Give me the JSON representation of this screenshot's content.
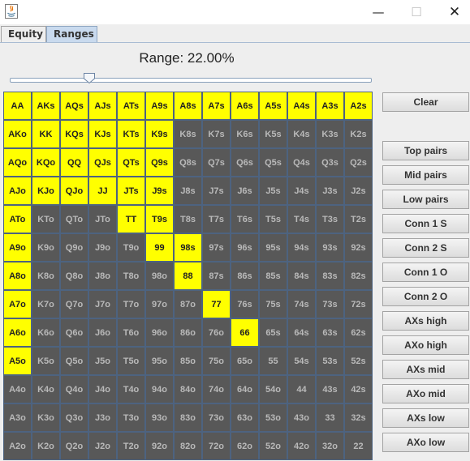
{
  "window": {
    "minimize": "—",
    "maximize": "☐",
    "close": "✕"
  },
  "tabs": [
    {
      "label": "Equity",
      "active": false
    },
    {
      "label": "Ranges",
      "active": true
    }
  ],
  "range_label": "Range: 22.00%",
  "slider": {
    "value_percent": 22
  },
  "grid": [
    [
      "AA",
      "AKs",
      "AQs",
      "AJs",
      "ATs",
      "A9s",
      "A8s",
      "A7s",
      "A6s",
      "A5s",
      "A4s",
      "A3s",
      "A2s"
    ],
    [
      "AKo",
      "KK",
      "KQs",
      "KJs",
      "KTs",
      "K9s",
      "K8s",
      "K7s",
      "K6s",
      "K5s",
      "K4s",
      "K3s",
      "K2s"
    ],
    [
      "AQo",
      "KQo",
      "QQ",
      "QJs",
      "QTs",
      "Q9s",
      "Q8s",
      "Q7s",
      "Q6s",
      "Q5s",
      "Q4s",
      "Q3s",
      "Q2s"
    ],
    [
      "AJo",
      "KJo",
      "QJo",
      "JJ",
      "JTs",
      "J9s",
      "J8s",
      "J7s",
      "J6s",
      "J5s",
      "J4s",
      "J3s",
      "J2s"
    ],
    [
      "ATo",
      "KTo",
      "QTo",
      "JTo",
      "TT",
      "T9s",
      "T8s",
      "T7s",
      "T6s",
      "T5s",
      "T4s",
      "T3s",
      "T2s"
    ],
    [
      "A9o",
      "K9o",
      "Q9o",
      "J9o",
      "T9o",
      "99",
      "98s",
      "97s",
      "96s",
      "95s",
      "94s",
      "93s",
      "92s"
    ],
    [
      "A8o",
      "K8o",
      "Q8o",
      "J8o",
      "T8o",
      "98o",
      "88",
      "87s",
      "86s",
      "85s",
      "84s",
      "83s",
      "82s"
    ],
    [
      "A7o",
      "K7o",
      "Q7o",
      "J7o",
      "T7o",
      "97o",
      "87o",
      "77",
      "76s",
      "75s",
      "74s",
      "73s",
      "72s"
    ],
    [
      "A6o",
      "K6o",
      "Q6o",
      "J6o",
      "T6o",
      "96o",
      "86o",
      "76o",
      "66",
      "65s",
      "64s",
      "63s",
      "62s"
    ],
    [
      "A5o",
      "K5o",
      "Q5o",
      "J5o",
      "T5o",
      "95o",
      "85o",
      "75o",
      "65o",
      "55",
      "54s",
      "53s",
      "52s"
    ],
    [
      "A4o",
      "K4o",
      "Q4o",
      "J4o",
      "T4o",
      "94o",
      "84o",
      "74o",
      "64o",
      "54o",
      "44",
      "43s",
      "42s"
    ],
    [
      "A3o",
      "K3o",
      "Q3o",
      "J3o",
      "T3o",
      "93o",
      "83o",
      "73o",
      "63o",
      "53o",
      "43o",
      "33",
      "32s"
    ],
    [
      "A2o",
      "K2o",
      "Q2o",
      "J2o",
      "T2o",
      "92o",
      "82o",
      "72o",
      "62o",
      "52o",
      "42o",
      "32o",
      "22"
    ]
  ],
  "selected": [
    "AA",
    "AKs",
    "AQs",
    "AJs",
    "ATs",
    "A9s",
    "A8s",
    "A7s",
    "A6s",
    "A5s",
    "A4s",
    "A3s",
    "A2s",
    "AKo",
    "KK",
    "KQs",
    "KJs",
    "KTs",
    "K9s",
    "AQo",
    "KQo",
    "QQ",
    "QJs",
    "QTs",
    "Q9s",
    "AJo",
    "KJo",
    "QJo",
    "JJ",
    "JTs",
    "J9s",
    "ATo",
    "TT",
    "T9s",
    "A9o",
    "99",
    "98s",
    "A8o",
    "88",
    "A7o",
    "77",
    "A6o",
    "66",
    "A5o"
  ],
  "colors": {
    "selected": "#ffff00",
    "unselected": "#585858",
    "cell_border": "#4d6380"
  },
  "buttons": [
    "Clear",
    "Top pairs",
    "Mid pairs",
    "Low pairs",
    "Conn 1 S",
    "Conn 2 S",
    "Conn 1 O",
    "Conn 2 O",
    "AXs high",
    "AXo high",
    "AXs mid",
    "AXo mid",
    "AXs low",
    "AXo low"
  ]
}
